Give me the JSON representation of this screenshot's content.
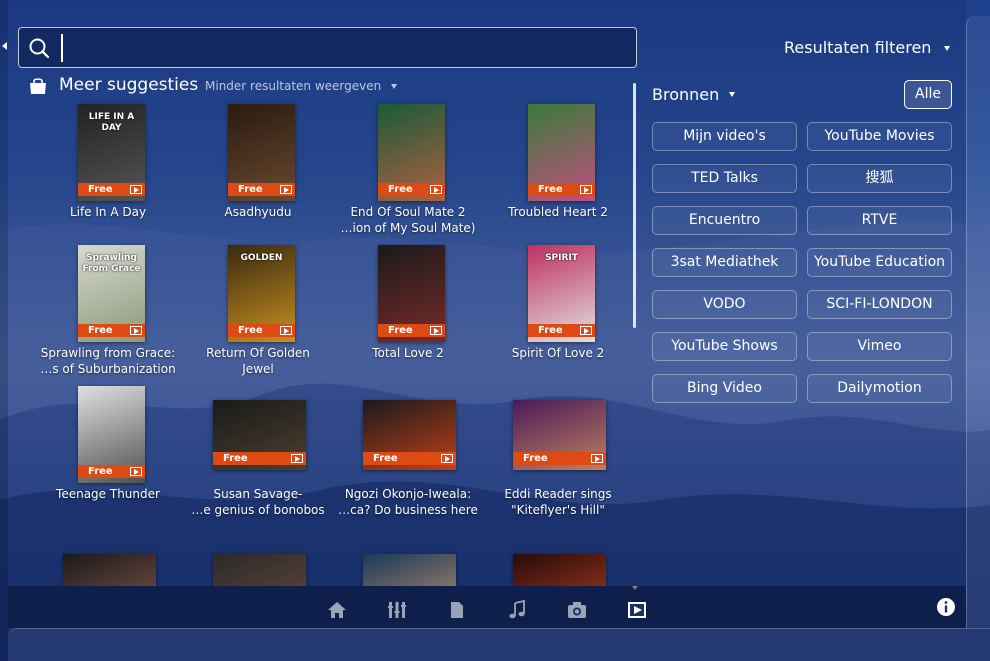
{
  "search": {
    "value": "",
    "placeholder": ""
  },
  "category": {
    "title": "Meer suggesties",
    "toggle_label": "Minder resultaten weergeven"
  },
  "results": [
    {
      "title_lines": [
        "Life In A Day"
      ],
      "free_label": "Free",
      "poster_text": "LIFE IN A DAY",
      "poster_colors": [
        "#222",
        "#555"
      ],
      "shape": "portrait"
    },
    {
      "title_lines": [
        "Asadhyudu"
      ],
      "free_label": "Free",
      "poster_text": "",
      "poster_colors": [
        "#2a1a10",
        "#6a4a30"
      ],
      "shape": "portrait"
    },
    {
      "title_lines": [
        "End Of Soul Mate 2",
        "…ion of My Soul Mate)"
      ],
      "free_label": "Free",
      "poster_text": "",
      "poster_colors": [
        "#1a5a3a",
        "#b06040"
      ],
      "shape": "portrait"
    },
    {
      "title_lines": [
        "Troubled Heart 2"
      ],
      "free_label": "Free",
      "poster_text": "",
      "poster_colors": [
        "#3a7a3a",
        "#c05080"
      ],
      "shape": "portrait"
    },
    {
      "title_lines": [
        "Sprawling from Grace:",
        "…s of Suburbanization"
      ],
      "free_label": "Free",
      "poster_text": "Sprawling From Grace",
      "poster_colors": [
        "#d8d8d0",
        "#8a9a7a"
      ],
      "shape": "portrait"
    },
    {
      "title_lines": [
        "Return Of Golden",
        "Jewel"
      ],
      "free_label": "Free",
      "poster_text": "GOLDEN",
      "poster_colors": [
        "#3a2a10",
        "#c89020"
      ],
      "shape": "portrait"
    },
    {
      "title_lines": [
        "Total Love 2"
      ],
      "free_label": "Free",
      "poster_text": "",
      "poster_colors": [
        "#1a1a1a",
        "#7a2a2a"
      ],
      "shape": "portrait"
    },
    {
      "title_lines": [
        "Spirit Of Love 2"
      ],
      "free_label": "Free",
      "poster_text": "SPIRIT",
      "poster_colors": [
        "#c03060",
        "#e0e0e0"
      ],
      "shape": "portrait"
    },
    {
      "title_lines": [
        "Teenage Thunder"
      ],
      "free_label": "Free",
      "poster_text": "",
      "poster_colors": [
        "#e0e0e0",
        "#505050"
      ],
      "shape": "portrait"
    },
    {
      "title_lines": [
        "Susan Savage-",
        "…e genius of bonobos"
      ],
      "free_label": "Free",
      "poster_text": "",
      "poster_colors": [
        "#1a1a18",
        "#4a4030"
      ],
      "shape": "landscape"
    },
    {
      "title_lines": [
        "Ngozi Okonjo-Iweala:",
        "…ca? Do business here"
      ],
      "free_label": "Free",
      "poster_text": "",
      "poster_colors": [
        "#1a1a1a",
        "#c0401a"
      ],
      "shape": "landscape"
    },
    {
      "title_lines": [
        "Eddi Reader sings",
        "\"Kiteflyer's Hill\""
      ],
      "free_label": "Free",
      "poster_text": "",
      "poster_colors": [
        "#4a1a5a",
        "#c08060"
      ],
      "shape": "landscape"
    },
    {
      "title_lines": [
        ""
      ],
      "free_label": "",
      "poster_text": "",
      "poster_colors": [
        "#1a1a1a",
        "#8a5a4a"
      ],
      "shape": "landscape"
    },
    {
      "title_lines": [
        ""
      ],
      "free_label": "",
      "poster_text": "",
      "poster_colors": [
        "#2a2a2a",
        "#6a4a3a"
      ],
      "shape": "landscape"
    },
    {
      "title_lines": [
        ""
      ],
      "free_label": "",
      "poster_text": "",
      "poster_colors": [
        "#1a3a5a",
        "#c09070"
      ],
      "shape": "landscape"
    },
    {
      "title_lines": [
        ""
      ],
      "free_label": "",
      "poster_text": "",
      "poster_colors": [
        "#2a0a0a",
        "#b04020"
      ],
      "shape": "landscape"
    }
  ],
  "filters": {
    "title": "Resultaten filteren",
    "sources_label": "Bronnen",
    "all_label": "Alle",
    "sources": [
      "Mijn video's",
      "YouTube Movies",
      "TED Talks",
      "搜狐",
      "Encuentro",
      "RTVE",
      "3sat Mediathek",
      "YouTube Education",
      "VODO",
      "SCI-FI-LONDON",
      "YouTube Shows",
      "Vimeo",
      "Bing Video",
      "Dailymotion"
    ]
  },
  "lenses": [
    "home-icon",
    "applications-icon",
    "files-icon",
    "music-icon",
    "photos-icon",
    "video-icon"
  ],
  "colors": {
    "accent": "#de4a13",
    "active_lens": "#ffffff",
    "inactive_lens": "#9aa4b8"
  }
}
